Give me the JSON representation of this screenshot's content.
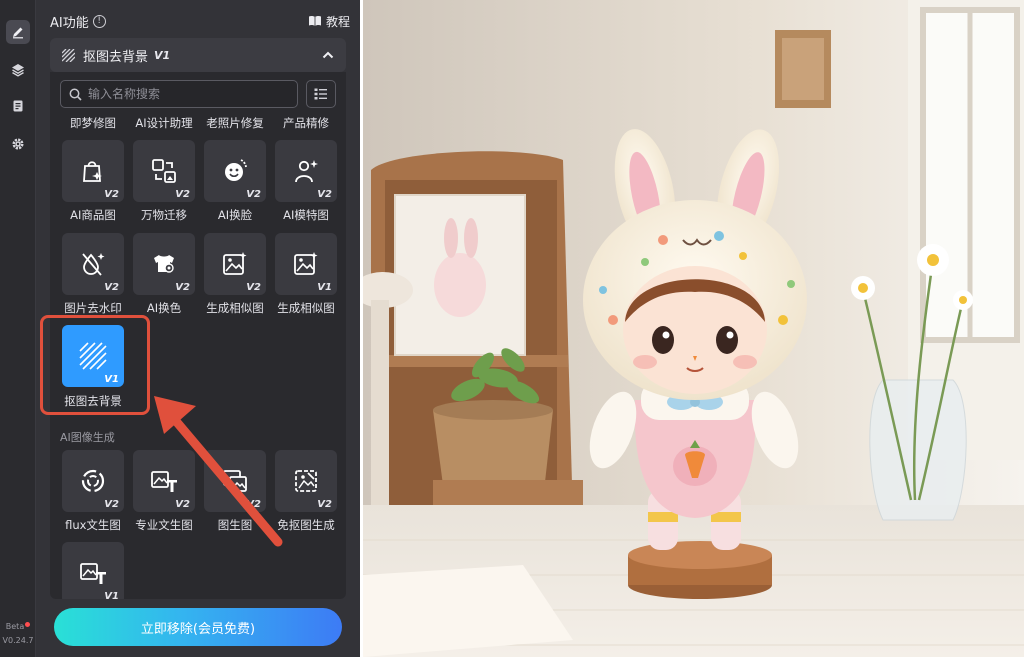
{
  "panel": {
    "title": "AI功能",
    "tutorial_label": "教程",
    "section": {
      "title": "抠图去背景",
      "version": "V1"
    },
    "search": {
      "placeholder": "输入名称搜索"
    },
    "top_row": [
      "即梦修图",
      "AI设计助理",
      "老照片修复",
      "产品精修"
    ],
    "tools": [
      {
        "label": "AI商品图",
        "version": "V2",
        "icon": "shopping-bag-sparkle-icon"
      },
      {
        "label": "万物迁移",
        "version": "V2",
        "icon": "transfer-image-icon"
      },
      {
        "label": "AI换脸",
        "version": "V2",
        "icon": "face-swap-icon"
      },
      {
        "label": "AI模特图",
        "version": "V2",
        "icon": "model-sparkle-icon"
      },
      {
        "label": "图片去水印",
        "version": "V2",
        "icon": "watermark-remove-icon"
      },
      {
        "label": "AI换色",
        "version": "V2",
        "icon": "shirt-recolor-icon"
      },
      {
        "label": "生成相似图",
        "version": "V2",
        "icon": "similar-image-icon"
      },
      {
        "label": "生成相似图",
        "version": "V1",
        "icon": "similar-image-icon"
      },
      {
        "label": "抠图去背景",
        "version": "V1",
        "icon": "cutout-stripes-icon"
      }
    ],
    "group2_label": "AI图像生成",
    "gen_tools": [
      {
        "label": "flux文生图",
        "version": "V2",
        "icon": "swirl-icon"
      },
      {
        "label": "专业文生图",
        "version": "V2",
        "icon": "image-text-icon"
      },
      {
        "label": "图生图",
        "version": "V2",
        "icon": "image-to-image-icon"
      },
      {
        "label": "免抠图生成",
        "version": "V2",
        "icon": "image-cutout-icon"
      },
      {
        "label": "",
        "version": "V1",
        "icon": "image-text-icon"
      }
    ],
    "cta_label": "立即移除(会员免费)"
  },
  "rail": {
    "beta": "Beta",
    "version": "V0.24.7"
  },
  "colors": {
    "accent": "#2f9bff",
    "highlight": "#e0503c"
  }
}
